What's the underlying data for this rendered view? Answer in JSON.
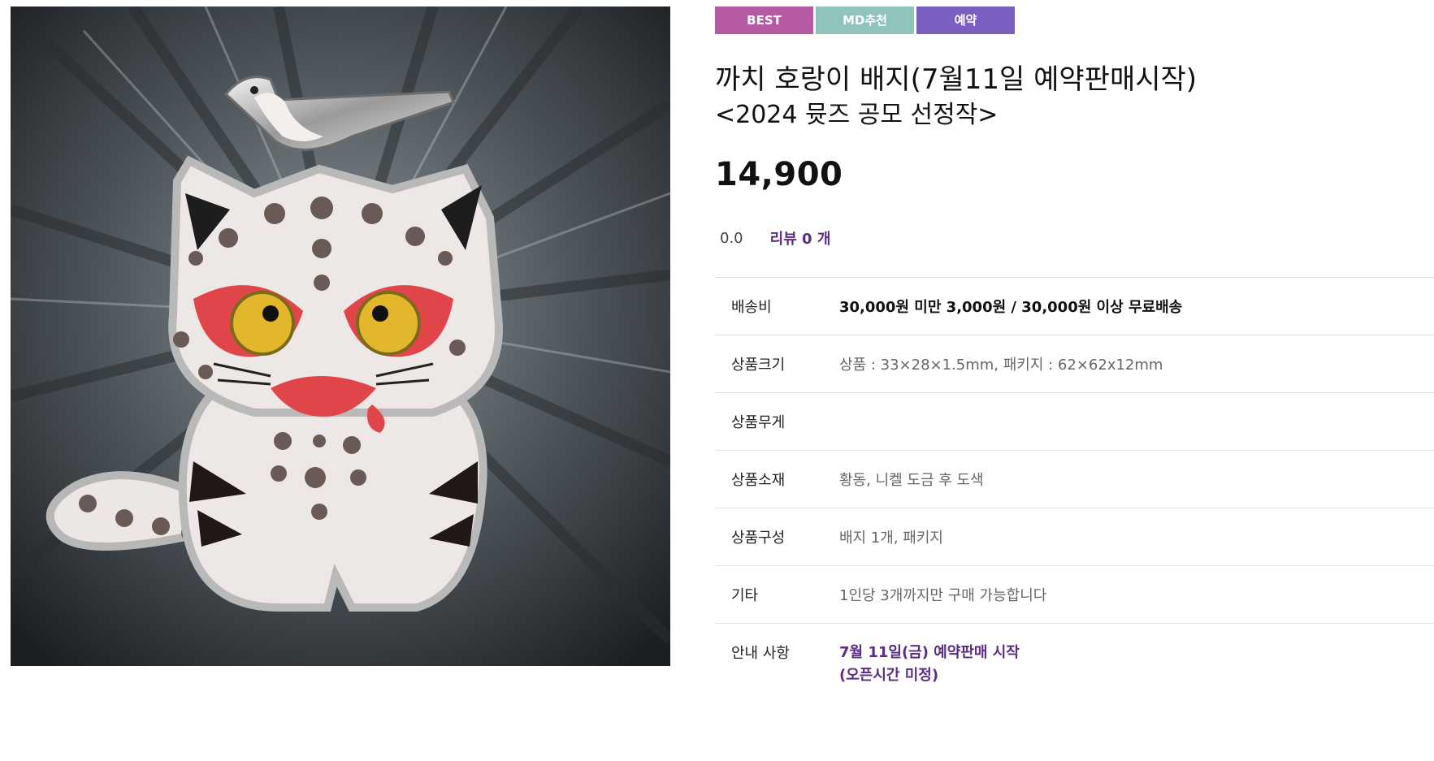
{
  "badges": [
    {
      "label": "BEST",
      "color": "#b75aa6"
    },
    {
      "label": "MD추천",
      "color": "#8fc3bb"
    },
    {
      "label": "예약",
      "color": "#7b60c2"
    }
  ],
  "product": {
    "title": "까치 호랑이 배지(7월11일 예약판매시작)",
    "subtitle": "<2024 뮷즈 공모 선정작>",
    "price": "14,900",
    "rating": "0.0",
    "review_label": "리뷰 0 개"
  },
  "specs": [
    {
      "label": "배송비",
      "value": "30,000원 미만 3,000원 / 30,000원 이상 무료배송"
    },
    {
      "label": "상품크기",
      "value": "상품 : 33×28×1.5mm, 패키지 : 62×62x12mm"
    },
    {
      "label": "상품무게",
      "value": ""
    },
    {
      "label": "상품소재",
      "value": "황동, 니켈 도금 후 도색"
    },
    {
      "label": "상품구성",
      "value": "배지 1개, 패키지"
    },
    {
      "label": "기타",
      "value": "1인당 3개까지만 구매 가능합니다"
    }
  ],
  "notice": {
    "label": "안내 사항",
    "line1": "7월 11일(금) 예약판매 시작",
    "line2": "(오픈시간 미정)"
  },
  "colors": {
    "accent": "#5b2c83"
  }
}
